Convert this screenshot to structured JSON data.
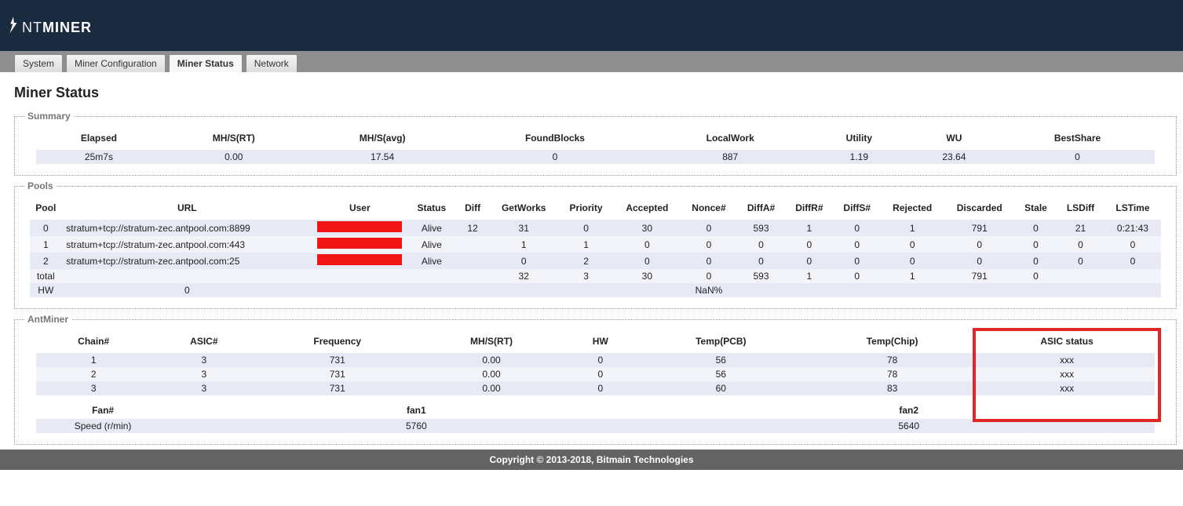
{
  "brand": {
    "prefix": "NT",
    "suffix": "MINER"
  },
  "tabs": {
    "system": "System",
    "minerconfig": "Miner Configuration",
    "minerstatus": "Miner Status",
    "network": "Network"
  },
  "page_title": "Miner Status",
  "legends": {
    "summary": "Summary",
    "pools": "Pools",
    "antminer": "AntMiner"
  },
  "summary": {
    "headers": {
      "elapsed": "Elapsed",
      "mhs_rt": "MH/S(RT)",
      "mhs_avg": "MH/S(avg)",
      "foundblocks": "FoundBlocks",
      "localwork": "LocalWork",
      "utility": "Utility",
      "wu": "WU",
      "bestshare": "BestShare"
    },
    "row": {
      "elapsed": "25m7s",
      "mhs_rt": "0.00",
      "mhs_avg": "17.54",
      "foundblocks": "0",
      "localwork": "887",
      "utility": "1.19",
      "wu": "23.64",
      "bestshare": "0"
    }
  },
  "pools": {
    "headers": {
      "pool": "Pool",
      "url": "URL",
      "user": "User",
      "status": "Status",
      "diff": "Diff",
      "getworks": "GetWorks",
      "priority": "Priority",
      "accepted": "Accepted",
      "nonce": "Nonce#",
      "diffa": "DiffA#",
      "diffr": "DiffR#",
      "diffs": "DiffS#",
      "rejected": "Rejected",
      "discarded": "Discarded",
      "stale": "Stale",
      "lsdiff": "LSDiff",
      "lstime": "LSTime"
    },
    "rows": [
      {
        "pool": "0",
        "url": "stratum+tcp://stratum-zec.antpool.com:8899",
        "user": "__RED__",
        "status": "Alive",
        "diff": "12",
        "getworks": "31",
        "priority": "0",
        "accepted": "30",
        "nonce": "0",
        "diffa": "593",
        "diffr": "1",
        "diffs": "0",
        "rejected": "1",
        "discarded": "791",
        "stale": "0",
        "lsdiff": "21",
        "lstime": "0:21:43"
      },
      {
        "pool": "1",
        "url": "stratum+tcp://stratum-zec.antpool.com:443",
        "user": "__RED__",
        "status": "Alive",
        "diff": "",
        "getworks": "1",
        "priority": "1",
        "accepted": "0",
        "nonce": "0",
        "diffa": "0",
        "diffr": "0",
        "diffs": "0",
        "rejected": "0",
        "discarded": "0",
        "stale": "0",
        "lsdiff": "0",
        "lstime": "0"
      },
      {
        "pool": "2",
        "url": "stratum+tcp://stratum-zec.antpool.com:25",
        "user": "__RED__",
        "status": "Alive",
        "diff": "",
        "getworks": "0",
        "priority": "2",
        "accepted": "0",
        "nonce": "0",
        "diffa": "0",
        "diffr": "0",
        "diffs": "0",
        "rejected": "0",
        "discarded": "0",
        "stale": "0",
        "lsdiff": "0",
        "lstime": "0"
      }
    ],
    "total": {
      "label": "total",
      "getworks": "32",
      "priority": "3",
      "accepted": "30",
      "nonce": "0",
      "diffa": "593",
      "diffr": "1",
      "diffs": "0",
      "rejected": "1",
      "discarded": "791",
      "stale": "0"
    },
    "hw": {
      "label": "HW",
      "value": "0",
      "nonce": "NaN%"
    }
  },
  "antminer": {
    "chain_headers": {
      "chain": "Chain#",
      "asic": "ASIC#",
      "freq": "Frequency",
      "mhs_rt": "MH/S(RT)",
      "hw": "HW",
      "temp_pcb": "Temp(PCB)",
      "temp_chip": "Temp(Chip)",
      "asic_status": "ASIC status"
    },
    "chains": [
      {
        "chain": "1",
        "asic": "3",
        "freq": "731",
        "mhs_rt": "0.00",
        "hw": "0",
        "temp_pcb": "56",
        "temp_chip": "78",
        "asic_status": "xxx"
      },
      {
        "chain": "2",
        "asic": "3",
        "freq": "731",
        "mhs_rt": "0.00",
        "hw": "0",
        "temp_pcb": "56",
        "temp_chip": "78",
        "asic_status": "xxx"
      },
      {
        "chain": "3",
        "asic": "3",
        "freq": "731",
        "mhs_rt": "0.00",
        "hw": "0",
        "temp_pcb": "60",
        "temp_chip": "83",
        "asic_status": "xxx"
      }
    ],
    "fan_headers": {
      "fan": "Fan#",
      "fan1": "fan1",
      "fan2": "fan2"
    },
    "fan_row": {
      "label": "Speed (r/min)",
      "fan1": "5760",
      "fan2": "5640"
    }
  },
  "footer": "Copyright © 2013-2018, Bitmain Technologies"
}
